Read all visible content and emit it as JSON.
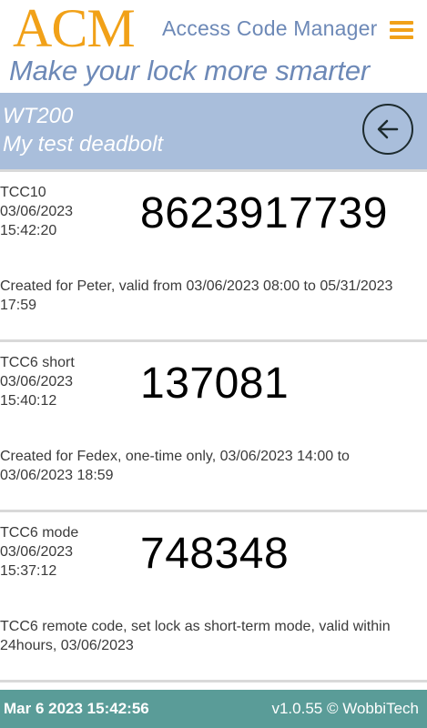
{
  "header": {
    "logo_text": "ACM",
    "app_title": "Access Code Manager",
    "tagline": "Make your lock more smarter",
    "menu_icon": "hamburger-menu-icon",
    "accent_color": "#f1a118",
    "brand_blue": "#6d89b7"
  },
  "device": {
    "name": "WT200",
    "description": "My test deadbolt",
    "back_icon": "arrow-left-circle-icon",
    "bar_color": "#a9bedb"
  },
  "codes": [
    {
      "label": "TCC10",
      "date": "03/06/2023",
      "time": "15:42:20",
      "code": "8623917739",
      "description": "Created for Peter, valid from 03/06/2023 08:00 to 05/31/2023 17:59"
    },
    {
      "label": "TCC6 short",
      "date": "03/06/2023",
      "time": "15:40:12",
      "code": "137081",
      "description": "Created for Fedex, one-time only, 03/06/2023 14:00 to 03/06/2023 18:59"
    },
    {
      "label": "TCC6 mode",
      "date": "03/06/2023",
      "time": "15:37:12",
      "code": "748348",
      "description": "TCC6 remote code, set lock as short-term mode, valid within 24hours, 03/06/2023"
    }
  ],
  "footer": {
    "datetime": "Mar 6 2023 15:42:56",
    "version": "v1.0.55 © WobbiTech",
    "bar_color": "#5a9c98"
  }
}
